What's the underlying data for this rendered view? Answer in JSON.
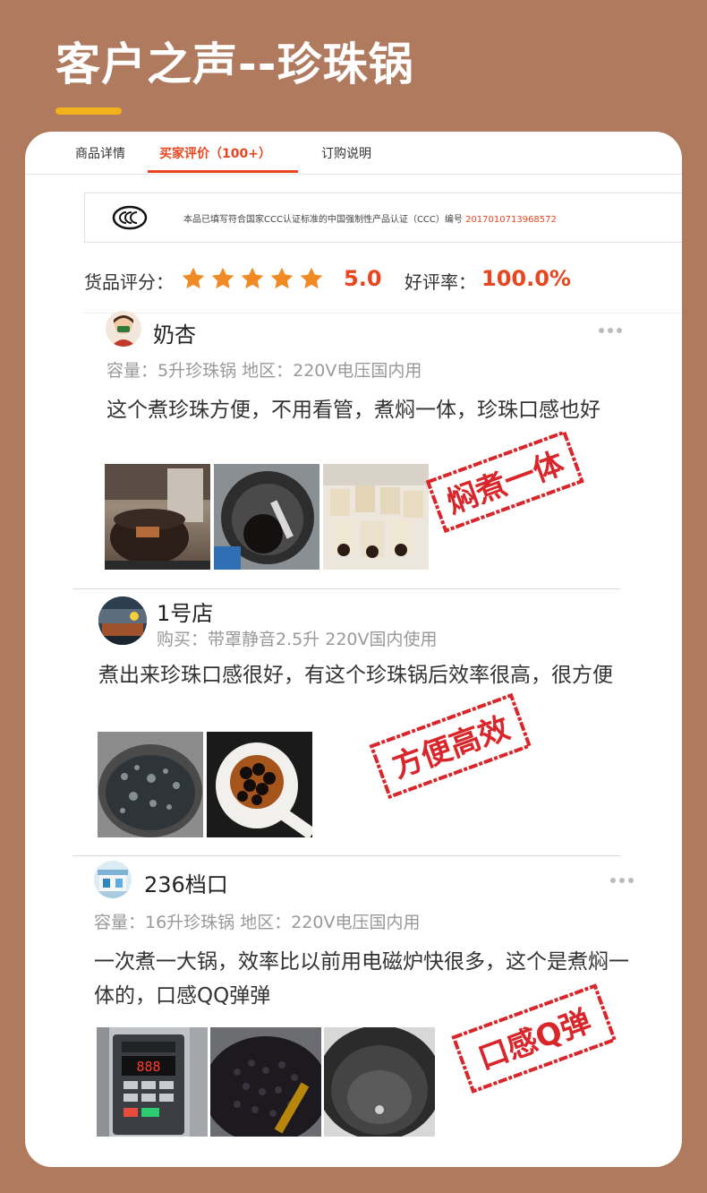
{
  "page": {
    "title": "客户之声--珍珠锅"
  },
  "tabs": [
    {
      "label": "商品详情"
    },
    {
      "label": "买家评价（100+）",
      "active": true
    },
    {
      "label": "订购说明"
    }
  ],
  "certification": {
    "logo": "CCC",
    "text": "本品已填写符合国家CCC认证标准的中国强制性产品认证（CCC）编号 ",
    "code": "2017010713968572"
  },
  "rating": {
    "label": "货品评分：",
    "stars": 5,
    "score": "5.0",
    "good_label": "好评率：",
    "good_rate": "100.0%"
  },
  "reviews": [
    {
      "user": "奶杏",
      "meta": "容量：5升珍珠锅 地区：220V电压国内用",
      "text": "这个煮珍珠方便，不用看管，煮焖一体，珍珠口感也好",
      "stamp": "焖煮一体",
      "photos": [
        "cooker-photo",
        "pearls-in-pot-photo",
        "milk-tea-cups-photo"
      ]
    },
    {
      "user": "1号店",
      "meta": "购买：带罩静音2.5升 220V国内使用",
      "text": "煮出来珍珠口感很好，有这个珍珠锅后效率很高，很方便",
      "stamp": "方便高效",
      "photos": [
        "boiling-pot-photo",
        "pearls-on-spoon-photo"
      ]
    },
    {
      "user": "236档口",
      "meta": "容量：16升珍珠锅 地区：220V电压国内用",
      "text": "一次煮一大锅，效率比以前用电磁炉快很多，这个是煮焖一体的，口感QQ弹弹",
      "stamp": "口感Q弹",
      "photos": [
        "control-panel-photo",
        "cooked-pearls-photo",
        "empty-pot-photo"
      ]
    }
  ],
  "colors": {
    "background": "#b07a5f",
    "accent": "#e8461e",
    "underline": "#f2b21b",
    "star": "#f08a24",
    "stamp": "#d8262b"
  }
}
